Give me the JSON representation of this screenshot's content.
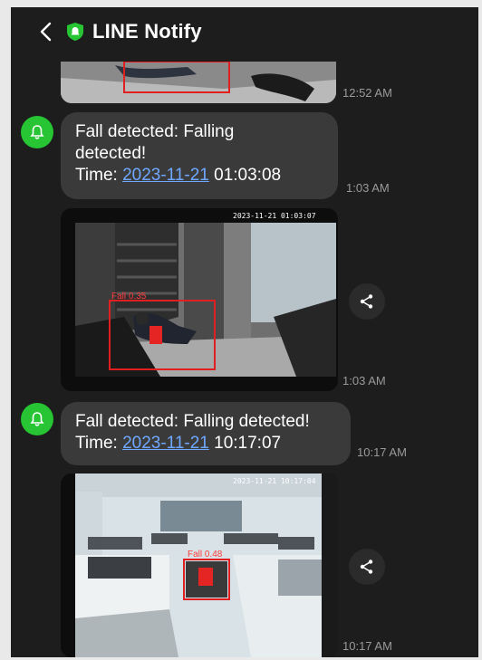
{
  "app": {
    "title": "LINE Notify",
    "back_icon": "chevron-left-icon",
    "logo_icon": "shield-bell-icon",
    "accent": "#27c533"
  },
  "messages": [
    {
      "type": "image",
      "time": "12:52 AM"
    },
    {
      "type": "text",
      "line1": "Fall detected: Falling",
      "line2": "detected!",
      "time_label": "Time: ",
      "date": "2023-11-21",
      "clock": " 01:03:08",
      "time": "1:03 AM"
    },
    {
      "type": "image",
      "cam_stamp": "2023-11-21 01:03:07",
      "det_label": "Fall 0.35",
      "time": "1:03 AM"
    },
    {
      "type": "text",
      "line1": "Fall detected: Falling detected!",
      "time_label": "Time: ",
      "date": "2023-11-21",
      "clock": " 10:17:07",
      "time": "10:17 AM"
    },
    {
      "type": "image",
      "cam_stamp": "2023-11-21 10:17:04",
      "det_label": "Fall 0.48",
      "time": "10:17 AM"
    }
  ]
}
